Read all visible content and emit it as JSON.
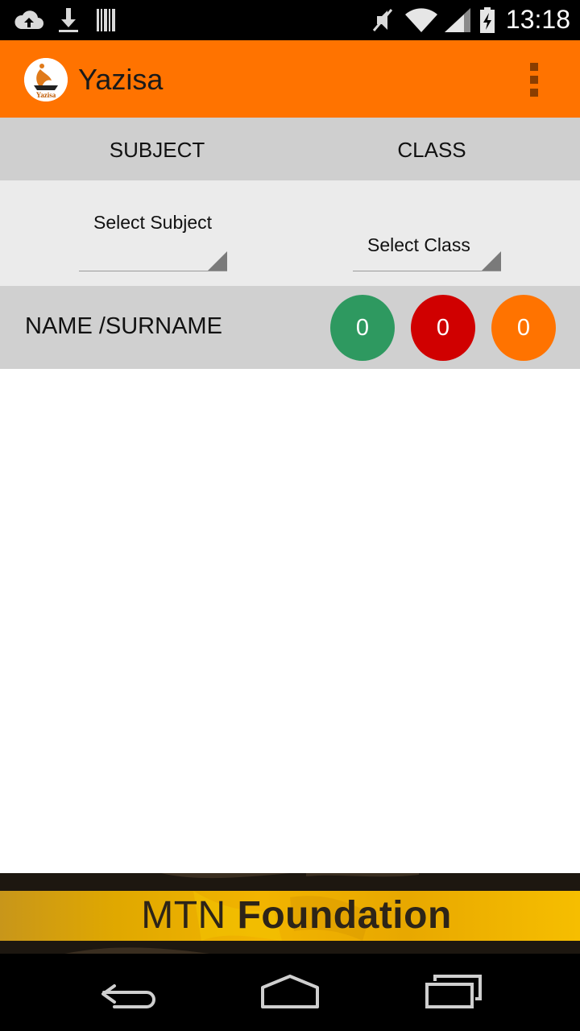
{
  "status_bar": {
    "time": "13:18",
    "icons": [
      "cloud-upload-icon",
      "download-icon",
      "barcode-icon",
      "mute-icon",
      "wifi-icon",
      "signal-icon",
      "battery-charging-icon"
    ]
  },
  "app_bar": {
    "title": "Yazisa",
    "logo_text": "Yazisa",
    "accent_color": "#ff7300"
  },
  "columns": {
    "subject_label": "SUBJECT",
    "class_label": "CLASS"
  },
  "filters": {
    "subject_selected": "Select Subject",
    "class_selected": "Select Class"
  },
  "roster_header": {
    "name_label": "NAME /SURNAME",
    "counts": [
      {
        "value": "0",
        "color": "#2e9960"
      },
      {
        "value": "0",
        "color": "#d00000"
      },
      {
        "value": "0",
        "color": "#ff7300"
      }
    ]
  },
  "list": {
    "items": []
  },
  "banner": {
    "text_light": "MTN ",
    "text_bold": "Foundation"
  },
  "nav_bar": {
    "buttons": [
      "back-icon",
      "home-icon",
      "recents-icon"
    ]
  }
}
